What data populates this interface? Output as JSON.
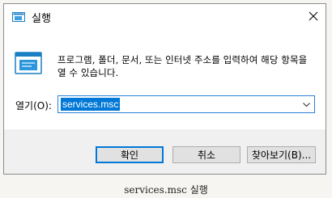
{
  "window": {
    "title": "실행",
    "title_icon": "run-dialog-icon",
    "close_icon": "close-icon"
  },
  "body": {
    "icon": "run-dialog-icon",
    "description": "프로그램, 폴더, 문서, 또는 인터넷 주소를 입력하여 해당 항목을 열 수 있습니다.",
    "open_label": "열기(O):",
    "open_value": "services.msc",
    "dropdown_icon": "chevron-down-icon"
  },
  "buttons": {
    "ok": "확인",
    "cancel": "취소",
    "browse": "찾아보기(B)..."
  },
  "caption": "services.msc 실행",
  "colors": {
    "accent": "#0078d7",
    "selection_bg": "#0078d7",
    "footer_bg": "#f0f0f0"
  }
}
